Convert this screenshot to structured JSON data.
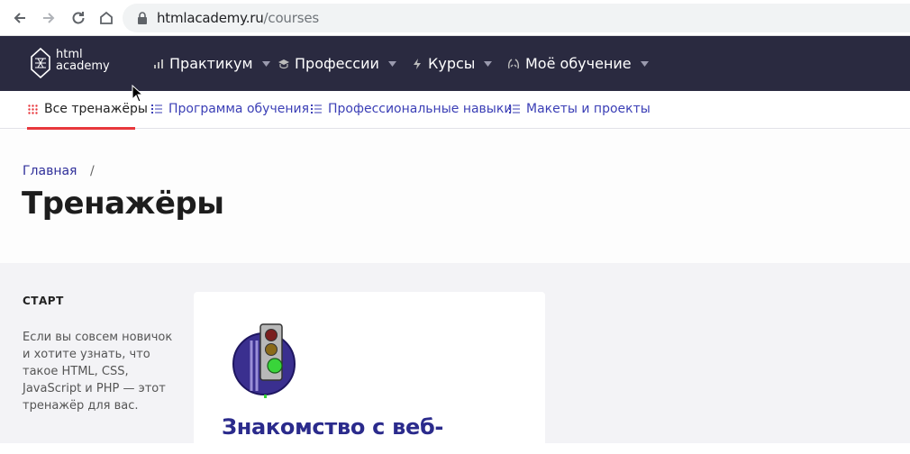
{
  "browser": {
    "url_domain": "htmlacademy.ru",
    "url_path": "/courses"
  },
  "logo": {
    "line1": "html",
    "line2": "academy"
  },
  "main_nav": {
    "items": [
      {
        "label": "Практикум",
        "icon": "bar-chart-icon"
      },
      {
        "label": "Профессии",
        "icon": "graduation-cap-icon"
      },
      {
        "label": "Курсы",
        "icon": "lightning-icon"
      },
      {
        "label": "Моё обучение",
        "icon": "laurel-icon"
      }
    ]
  },
  "sub_nav": {
    "items": [
      {
        "label": "Все тренажёры",
        "icon": "grid-dots-icon",
        "active": true
      },
      {
        "label": "Программа обучения",
        "icon": "list-icon"
      },
      {
        "label": "Профессиональные навыки",
        "icon": "list-icon"
      },
      {
        "label": "Макеты и проекты",
        "icon": "list-icon"
      }
    ]
  },
  "breadcrumb": {
    "home": "Главная",
    "separator": "/"
  },
  "page": {
    "title": "Тренажёры"
  },
  "sidebar": {
    "title": "СТАРТ",
    "description": "Если вы совсем новичок и хотите узнать, что такое HTML, CSS, JavaScript и PHP — этот тренажёр для вас."
  },
  "card": {
    "title": "Знакомство с веб-",
    "image": "traffic-light-illustration"
  },
  "colors": {
    "nav_bg": "#2a2a40",
    "accent": "#e8383d",
    "link": "#3b3fb6",
    "card_title": "#2b2b8c"
  }
}
